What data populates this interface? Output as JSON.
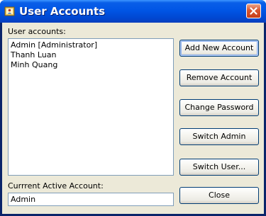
{
  "window": {
    "title": "User Accounts"
  },
  "user_accounts_label": "User accounts:",
  "accounts": [
    "Admin [Administrator]",
    "Thanh Luan",
    "Minh Quang"
  ],
  "current_active_label": "Currrent Active Account:",
  "current_active_value": "Admin",
  "buttons": {
    "add_new_account": "Add New Account",
    "remove_account": "Remove Account",
    "change_password": "Change Password",
    "switch_admin": "Switch Admin",
    "switch_user": "Switch User...",
    "close": "Close"
  },
  "icons": {
    "app": "user-accounts-icon",
    "close": "close-icon"
  },
  "colors": {
    "titlebar": "#0055e5",
    "dialog_background": "#ece9d8",
    "close_button": "#d8552f",
    "field_border": "#7f9db9",
    "button_border": "#003c74"
  }
}
